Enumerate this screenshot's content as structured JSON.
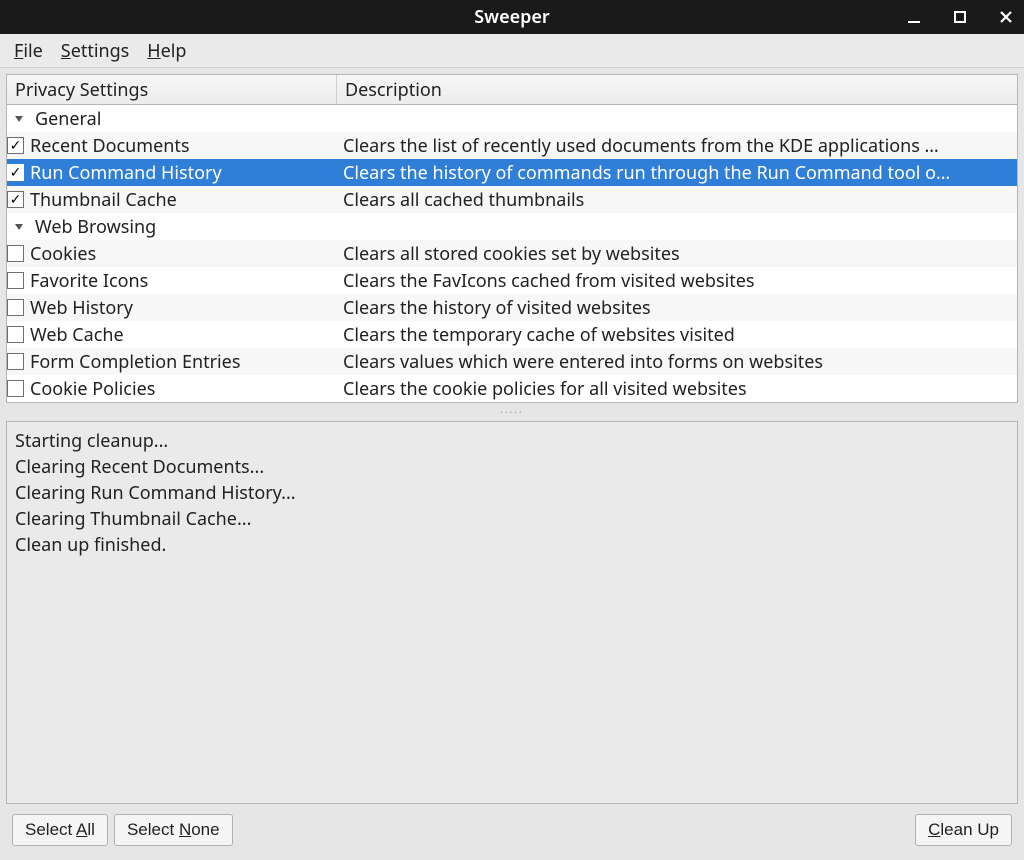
{
  "window": {
    "title": "Sweeper"
  },
  "menu": {
    "file": "File",
    "settings": "Settings",
    "help": "Help"
  },
  "columns": {
    "name": "Privacy Settings",
    "desc": "Description"
  },
  "groups": [
    {
      "label": "General",
      "items": [
        {
          "label": "Recent Documents",
          "checked": true,
          "selected": false,
          "desc": "Clears the list of recently used documents from the KDE applications …"
        },
        {
          "label": "Run Command History",
          "checked": true,
          "selected": true,
          "desc": "Clears the history of commands run through the Run Command tool o…"
        },
        {
          "label": "Thumbnail Cache",
          "checked": true,
          "selected": false,
          "desc": "Clears all cached thumbnails"
        }
      ]
    },
    {
      "label": "Web Browsing",
      "items": [
        {
          "label": "Cookies",
          "checked": false,
          "selected": false,
          "desc": "Clears all stored cookies set by websites"
        },
        {
          "label": "Favorite Icons",
          "checked": false,
          "selected": false,
          "desc": "Clears the FavIcons cached from visited websites"
        },
        {
          "label": "Web History",
          "checked": false,
          "selected": false,
          "desc": "Clears the history of visited websites"
        },
        {
          "label": "Web Cache",
          "checked": false,
          "selected": false,
          "desc": "Clears the temporary cache of websites visited"
        },
        {
          "label": "Form Completion Entries",
          "checked": false,
          "selected": false,
          "desc": "Clears values which were entered into forms on websites"
        },
        {
          "label": "Cookie Policies",
          "checked": false,
          "selected": false,
          "desc": "Clears the cookie policies for all visited websites"
        }
      ]
    }
  ],
  "log_lines": [
    "Starting cleanup...",
    "Clearing Recent Documents...",
    "Clearing Run Command History...",
    "Clearing Thumbnail Cache...",
    "Clean up finished."
  ],
  "buttons": {
    "select_all": "Select All",
    "select_none": "Select None",
    "clean_up": "Clean Up"
  }
}
